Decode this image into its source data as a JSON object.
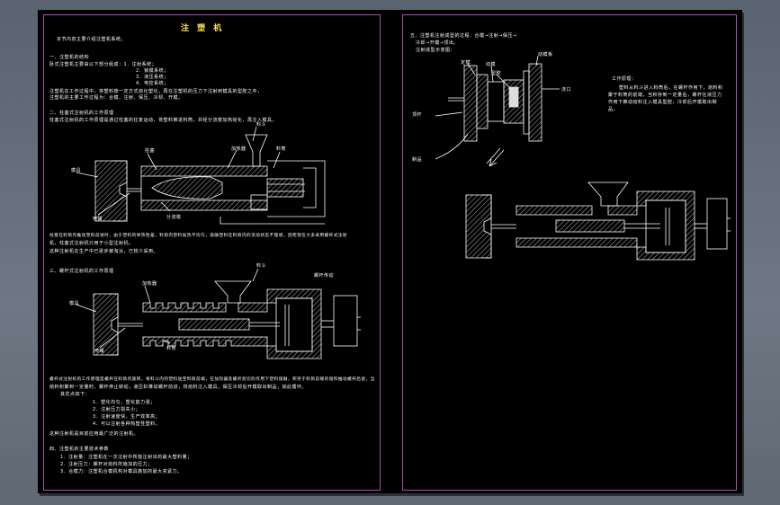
{
  "sheet": {
    "frame_color": "#b04bb5",
    "title_color": "#ffe24a",
    "left_page": {
      "title": "注 塑 机",
      "lines": [
        "本节内容主要介绍注塑机系统。",
        "一、注塑机的结构",
        "   卧式注塑机主要由以下部分组成：1．注射系统；",
        "2．锁模系统；",
        "3．液压系统；",
        "4．电控系统；",
        "   注塑机在工作过程中，将塑料按一定方式熔化塑化，再在注塑机的压力下注射到模具的型腔之中，",
        "   注塑机的主要工作过程为：合模、注射、保压、冷却、开模。",
        "二、柱塞式注射机的工作原理",
        "   柱塞式注射机的工作原理是通过柱塞的往复运动，将塑料推进料筒，并经分流梭加热熔化，再注入模具。",
        "   柱塞在料筒内推动塑料前进时，由于塑料的导热性差，料筒内塑料加热不均匀，熔融塑料在料筒内的流动状态不理想，因而现在大多采用螺杆式注射",
        "   机，柱塞式注射机只用于小型注射机。",
        "   这种注射机在生产中已逐步被淘汰，已较少采用。",
        "三、螺杆式注射机的工作原理",
        "   螺杆式注射机的工作原理是螺杆在料筒内旋转，将料斗内的塑料送至料筒前端，在加热器及螺杆剪切的作用下塑料熔融，积存于料筒前端的熔料推动螺杆后退，当",
        "   熔料积聚到一定量时，螺杆停止转动，液压缸推动螺杆前进，将熔料注入模具，保压冷却后开模取出制品，如此循环。",
        "   其优点如下：",
        "1．塑化均匀，塑化能力强；",
        "2．注射压力损失小；",
        "3．注射速度快，生产效率高；",
        "4．可以注射各种热塑性塑料。",
        "   这种注射机是目前应用最广泛的注射机。",
        "四、注塑机的主要技术参数",
        "1．注射量：注塑机在一次注射中所能注射出的最大塑料量；",
        "2．注射压力：螺杆对熔料所施加的压力；",
        "3．合模力：注塑机合模机构对模具施加的最大夹紧力。"
      ],
      "plunger_labels": [
        "料斗",
        "加热器",
        "料筒",
        "柱塞",
        "模具",
        "喷嘴",
        "分流梭"
      ],
      "screw_labels": [
        "加热器",
        "料斗",
        "螺杆传动",
        "模具",
        "喷嘴",
        "料筒"
      ]
    },
    "right_page": {
      "lines": [
        "五、注塑机注射成型的过程：合模→注射→保压→",
        "冷却→开模→顶出。",
        "注射成型示意图：",
        "工作原理：",
        "塑料从料斗进入料筒后，在螺杆作用下，熔料积",
        "聚于料筒的前端，当积存到一定量后，螺杆在液压力",
        "作用下推动熔料注入模具型腔，冷却后开模取出制",
        "品。"
      ],
      "mold_labels": [
        "定模",
        "动模",
        "型腔",
        "顶杆",
        "浇口",
        "制品",
        "动模板"
      ]
    }
  }
}
